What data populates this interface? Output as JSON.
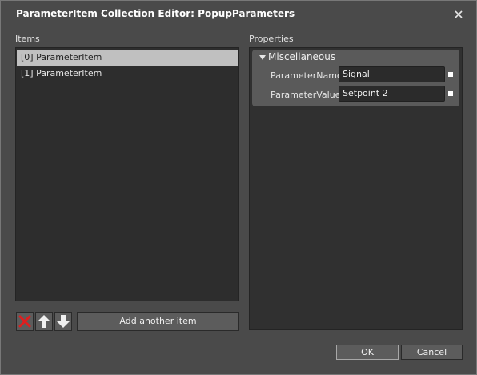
{
  "window": {
    "title": "ParameterItem Collection Editor: PopupParameters",
    "close_icon": "close-icon"
  },
  "items": {
    "label": "Items",
    "list": [
      {
        "label": "[0] ParameterItem",
        "selected": true
      },
      {
        "label": "[1] ParameterItem",
        "selected": false
      }
    ],
    "buttons": {
      "remove_icon": "delete-x-icon",
      "up_icon": "arrow-up-icon",
      "down_icon": "arrow-down-icon",
      "add_label": "Add another item"
    }
  },
  "properties": {
    "label": "Properties",
    "category": "Miscellaneous",
    "rows": [
      {
        "name": "ParameterName",
        "value": "Signal"
      },
      {
        "name": "ParameterValue",
        "value": "Setpoint 2"
      }
    ]
  },
  "footer": {
    "ok_label": "OK",
    "cancel_label": "Cancel"
  },
  "colors": {
    "window_bg": "#4a4a4a",
    "panel_bg": "#2d2d2d",
    "selection_bg": "#c0c0c0",
    "delete_red": "#e01e1e"
  }
}
